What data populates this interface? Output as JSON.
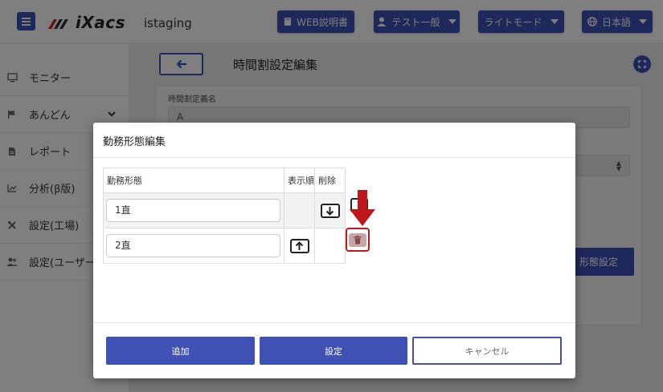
{
  "header": {
    "brand": "iXacs",
    "environment": "istaging",
    "manual_label": "WEB説明書",
    "user_label": "テスト一般",
    "mode_label": "ライトモード",
    "language_label": "日本語"
  },
  "sidebar": {
    "items": [
      {
        "label": "モニター",
        "icon": "monitor-icon"
      },
      {
        "label": "あんどん",
        "icon": "flag-icon",
        "expandable": true
      },
      {
        "label": "レポート",
        "icon": "document-icon"
      },
      {
        "label": "分析(β版)",
        "icon": "chart-icon"
      },
      {
        "label": "設定(工場)",
        "icon": "tools-icon"
      },
      {
        "label": "設定(ユーザー",
        "icon": "users-icon"
      }
    ]
  },
  "page": {
    "title": "時間割設定編集",
    "field_label": "時間割定義名",
    "field_value": "A",
    "background_button": "形態設定"
  },
  "modal": {
    "title": "勤務形態編集",
    "columns": [
      "勤務形態",
      "表示順",
      "削除"
    ],
    "rows": [
      {
        "name": "1直"
      },
      {
        "name": "2直"
      }
    ],
    "add_label": "追加",
    "save_label": "設定",
    "cancel_label": "キャンセル"
  },
  "colors": {
    "accent": "#3f51b5",
    "highlight": "#c0161c"
  }
}
